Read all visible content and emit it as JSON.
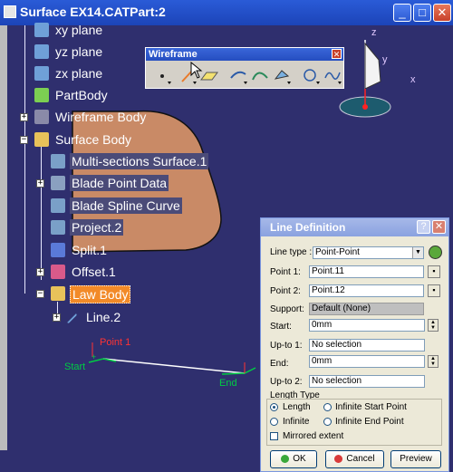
{
  "window": {
    "title": "Surface EX14.CATPart:2",
    "min": "_",
    "max": "□",
    "close": "✕"
  },
  "tree": {
    "items": [
      {
        "label": "xy plane",
        "icon": "plane-icon"
      },
      {
        "label": "yz plane",
        "icon": "plane-icon"
      },
      {
        "label": "zx plane",
        "icon": "plane-icon"
      },
      {
        "label": "PartBody",
        "icon": "gear-body-icon"
      },
      {
        "label": "Wireframe Body",
        "icon": "body-icon"
      },
      {
        "label": "Surface Body",
        "icon": "body-icon"
      },
      {
        "label": "Multi-sections Surface.1",
        "icon": "surface-icon"
      },
      {
        "label": "Blade Point Data",
        "icon": "data-icon"
      },
      {
        "label": "Blade Spline Curve",
        "icon": "spline-icon"
      },
      {
        "label": "Project.2",
        "icon": "project-icon"
      },
      {
        "label": "Split.1",
        "icon": "split-icon"
      },
      {
        "label": "Offset.1",
        "icon": "offset-icon"
      },
      {
        "label": "Law Body",
        "icon": "body-icon"
      },
      {
        "label": "Line.2",
        "icon": "line-icon"
      }
    ]
  },
  "toolbar": {
    "title": "Wireframe",
    "close": "✕"
  },
  "compass": {
    "x": "x",
    "y": "y",
    "z": "z"
  },
  "geometry": {
    "point1": "Point 1",
    "start": "Start",
    "end": "End"
  },
  "dialog": {
    "title": "Line Definition",
    "help": "?",
    "close": "✕",
    "line_type_label": "Line type :",
    "line_type_value": "Point-Point",
    "point1_label": "Point 1:",
    "point1_value": "Point.11",
    "point2_label": "Point 2:",
    "point2_value": "Point.12",
    "support_label": "Support:",
    "support_value": "Default (None)",
    "start_label": "Start:",
    "start_value": "0mm",
    "upto1_label": "Up-to 1:",
    "upto1_value": "No selection",
    "end_label": "End:",
    "end_value": "0mm",
    "upto2_label": "Up-to 2:",
    "upto2_value": "No selection",
    "length_type_label": "Length Type",
    "opt_length": "Length",
    "opt_infinite_start": "Infinite Start Point",
    "opt_infinite": "Infinite",
    "opt_infinite_end": "Infinite End Point",
    "mirrored": "Mirrored extent",
    "ok": "OK",
    "cancel": "Cancel",
    "preview": "Preview"
  },
  "colors": {
    "background": "#2f2f6e",
    "surface": "#c98a66",
    "selected": "#f28a28"
  }
}
